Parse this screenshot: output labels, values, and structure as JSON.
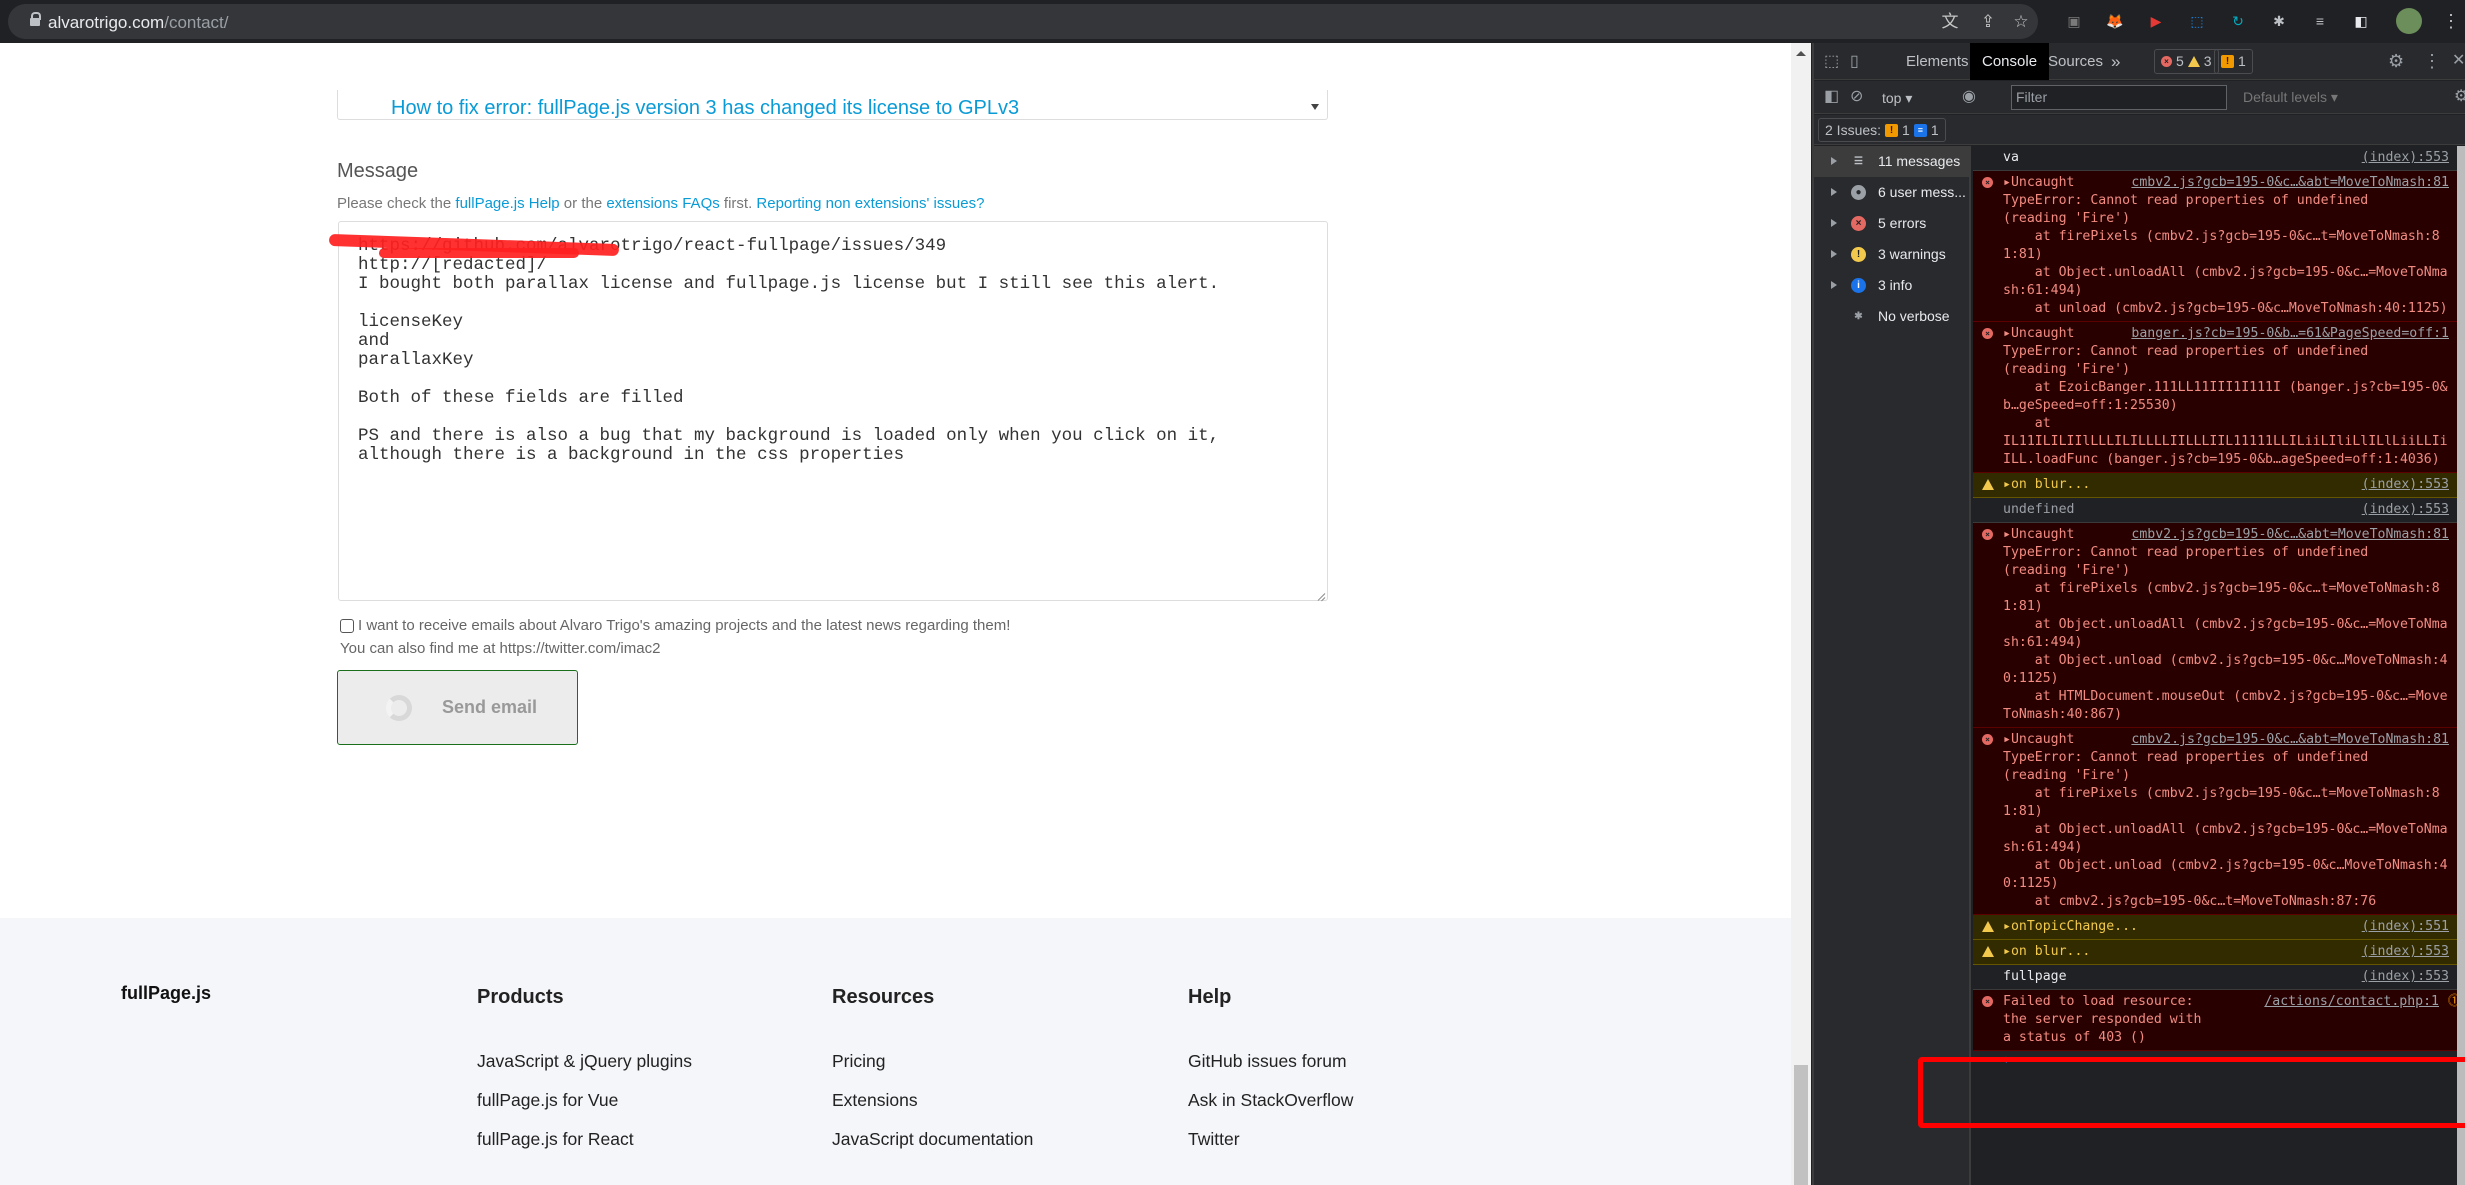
{
  "browser": {
    "url_host": "alvarotrigo.com",
    "url_path": "/contact/",
    "omnibox_icons": [
      "translate-icon",
      "share-icon",
      "bookmark-star-icon"
    ],
    "extensions": [
      {
        "name": "extension-1-icon",
        "glyph": "▣",
        "color": "#7a7a7a"
      },
      {
        "name": "metamask-fox-icon",
        "glyph": "🦊",
        "color": "#e2761b"
      },
      {
        "name": "youtube-play-icon",
        "glyph": "▶",
        "color": "#e53935"
      },
      {
        "name": "screenshot-capture-icon",
        "glyph": "⬚",
        "color": "#1e88e5"
      },
      {
        "name": "extension-refresh-icon",
        "glyph": "↻",
        "color": "#00acc1"
      },
      {
        "name": "extensions-puzzle-icon",
        "glyph": "✱",
        "color": "#bdc1c6"
      },
      {
        "name": "media-queue-icon",
        "glyph": "≡",
        "color": "#bdc1c6"
      },
      {
        "name": "side-panel-icon",
        "glyph": "◧",
        "color": "#e8eaed"
      }
    ]
  },
  "page": {
    "topic_select": "How to fix error: fullPage.js version 3 has changed its license to GPLv3",
    "message_label": "Message",
    "hint": {
      "prefix": "Please check the ",
      "link1": "fullPage.js Help",
      "middle": " or the ",
      "link2": "extensions FAQs",
      "suffix": " first. ",
      "link3": "Reporting non extensions' issues?"
    },
    "message_value": "https://github.com/alvarotrigo/react-fullpage/issues/349\nhttp://[redacted]/\nI bought both parallax license and fullpage.js license but I still see this alert.\n\nlicenseKey\nand\nparallaxKey\n\nBoth of these fields are filled\n\nPS and there is also a bug that my background is loaded only when you click on it,\nalthough there is a background in the css properties",
    "newsletter_label": "I want to receive emails about Alvaro Trigo's amazing projects and the latest news regarding them!",
    "newsletter_checked": false,
    "twitter_note": "You can also find me at https://twitter.com/imac2",
    "send_button": "Send email"
  },
  "footer": {
    "brand": "fullPage.js",
    "columns": [
      {
        "title": "Products",
        "links": [
          "JavaScript & jQuery plugins",
          "fullPage.js for Vue",
          "fullPage.js for React"
        ]
      },
      {
        "title": "Resources",
        "links": [
          "Pricing",
          "Extensions",
          "JavaScript documentation"
        ]
      },
      {
        "title": "Help",
        "links": [
          "GitHub issues forum",
          "Ask in StackOverflow",
          "Twitter"
        ]
      }
    ]
  },
  "devtools": {
    "tabs": [
      "Elements",
      "Console",
      "Sources"
    ],
    "active_tab": "Console",
    "more_tabs": "»",
    "error_count": "5",
    "warning_count": "3",
    "issue_count": "1",
    "context": "top",
    "filter_placeholder": "Filter",
    "levels": "Default levels",
    "issues_summary": {
      "label": "2 Issues:",
      "warn": "1",
      "info": "1"
    },
    "sidebar": [
      {
        "label": "11 messages",
        "icon": "list-icon",
        "expandable": true,
        "selected": true
      },
      {
        "label": "6 user mess...",
        "icon": "user-icon",
        "expandable": true
      },
      {
        "label": "5 errors",
        "icon": "error-icon",
        "expandable": true
      },
      {
        "label": "3 warnings",
        "icon": "warning-icon",
        "expandable": true
      },
      {
        "label": "3 info",
        "icon": "info-icon",
        "expandable": true
      },
      {
        "label": "No verbose",
        "icon": "bug-icon",
        "expandable": false
      }
    ],
    "messages": [
      {
        "type": "log",
        "text": "va",
        "source": "(index):553"
      },
      {
        "type": "error",
        "text": "▸Uncaught",
        "source": "cmbv2.js?gcb=195-0&c…&abt=MoveToNmash:81",
        "stack": "TypeError: Cannot read properties of undefined\n(reading 'Fire')\n    at firePixels (cmbv2.js?gcb=195-0&c…t=MoveToNmash:81:81)\n    at Object.unloadAll (cmbv2.js?gcb=195-0&c…=MoveToNmash:61:494)\n    at unload (cmbv2.js?gcb=195-0&c…MoveToNmash:40:1125)"
      },
      {
        "type": "error",
        "text": "▸Uncaught",
        "source": "banger.js?cb=195-0&b…=61&PageSpeed=off:1",
        "stack": "TypeError: Cannot read properties of undefined\n(reading 'Fire')\n    at EzoicBanger.111LL11III1I111I (banger.js?cb=195-0&b…geSpeed=off:1:25530)\n    at\nIL11ILILIIlLLLILILLLLIILLLIIL11111LLILiiLIliLlILlLiiLLIiILL.loadFunc (banger.js?cb=195-0&b…ageSpeed=off:1:4036)"
      },
      {
        "type": "warn",
        "text": "▸on blur...",
        "source": "(index):553"
      },
      {
        "type": "log",
        "text": "undefined",
        "source": "(index):553",
        "dim": true
      },
      {
        "type": "error",
        "text": "▸Uncaught",
        "source": "cmbv2.js?gcb=195-0&c…&abt=MoveToNmash:81",
        "stack": "TypeError: Cannot read properties of undefined\n(reading 'Fire')\n    at firePixels (cmbv2.js?gcb=195-0&c…t=MoveToNmash:81:81)\n    at Object.unloadAll (cmbv2.js?gcb=195-0&c…=MoveToNmash:61:494)\n    at Object.unload (cmbv2.js?gcb=195-0&c…MoveToNmash:40:1125)\n    at HTMLDocument.mouseOut (cmbv2.js?gcb=195-0&c…=MoveToNmash:40:867)"
      },
      {
        "type": "error",
        "text": "▸Uncaught",
        "source": "cmbv2.js?gcb=195-0&c…&abt=MoveToNmash:81",
        "stack": "TypeError: Cannot read properties of undefined\n(reading 'Fire')\n    at firePixels (cmbv2.js?gcb=195-0&c…t=MoveToNmash:81:81)\n    at Object.unloadAll (cmbv2.js?gcb=195-0&c…=MoveToNmash:61:494)\n    at Object.unload (cmbv2.js?gcb=195-0&c…MoveToNmash:40:1125)\n    at cmbv2.js?gcb=195-0&c…t=MoveToNmash:87:76"
      },
      {
        "type": "warn",
        "text": "▸onTopicChange...",
        "source": "(index):551"
      },
      {
        "type": "warn",
        "text": "▸on blur...",
        "source": "(index):553"
      },
      {
        "type": "log",
        "text": "fullpage",
        "source": "(index):553"
      },
      {
        "type": "error",
        "text": "Failed to load resource:\nthe server responded with\na status of 403 ()",
        "source": "/actions/contact.php:1",
        "network": true
      }
    ]
  }
}
